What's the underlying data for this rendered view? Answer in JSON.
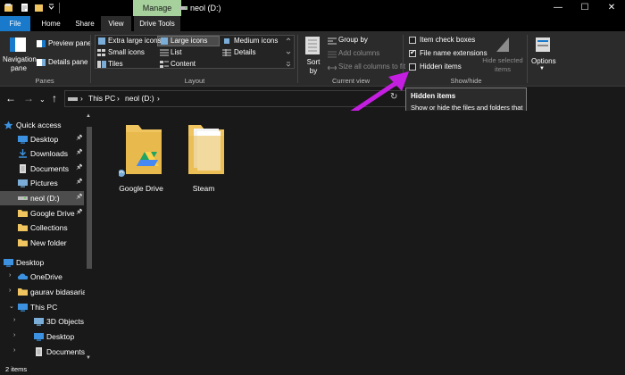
{
  "titlebar": {
    "manage_label": "Manage",
    "window_title": "neol (D:)",
    "minimize_glyph": "—",
    "maximize_glyph": "☐",
    "close_glyph": "✕"
  },
  "tabs": {
    "file": "File",
    "home": "Home",
    "share": "Share",
    "view": "View",
    "drive_tools": "Drive Tools"
  },
  "ribbon": {
    "panes": {
      "navigation_pane": "Navigation pane",
      "preview_pane": "Preview pane",
      "details_pane": "Details pane",
      "group_label": "Panes"
    },
    "layout": {
      "extra_large_icons": "Extra large icons",
      "large_icons": "Large icons",
      "medium_icons": "Medium icons",
      "small_icons": "Small icons",
      "list": "List",
      "details": "Details",
      "tiles": "Tiles",
      "content": "Content",
      "group_label": "Layout"
    },
    "current_view": {
      "sort_by": "Sort by",
      "group_by": "Group by",
      "add_columns": "Add columns",
      "size_all_columns": "Size all columns to fit",
      "group_label": "Current view"
    },
    "show_hide": {
      "item_check_boxes": "Item check boxes",
      "item_check_boxes_checked": false,
      "file_name_extensions": "File name extensions",
      "file_name_extensions_checked": true,
      "hidden_items": "Hidden items",
      "hidden_items_checked": false,
      "hide_selected_items": "Hide selected items",
      "group_label": "Show/hide"
    },
    "options": "Options"
  },
  "address": {
    "crumbs": [
      "This PC",
      "neol (D:)"
    ],
    "separator": "›"
  },
  "tooltip": {
    "title": "Hidden items",
    "body": "Show or hide the files and folders that are marked as hidden."
  },
  "nav": {
    "items": [
      {
        "label": "Quick access",
        "icon": "star-icon"
      },
      {
        "label": "Desktop",
        "icon": "desktop-icon"
      },
      {
        "label": "Downloads",
        "icon": "downloads-icon"
      },
      {
        "label": "Documents",
        "icon": "documents-icon"
      },
      {
        "label": "Pictures",
        "icon": "pictures-icon"
      },
      {
        "label": "neol (D:)",
        "icon": "drive-icon"
      },
      {
        "label": "Google Drive",
        "icon": "google-drive-icon"
      },
      {
        "label": "Collections",
        "icon": "folder-icon"
      },
      {
        "label": "New folder",
        "icon": "folder-icon"
      },
      {
        "label": "Desktop",
        "icon": "desktop-icon"
      },
      {
        "label": "OneDrive",
        "icon": "onedrive-icon"
      },
      {
        "label": "gaurav bidasaria",
        "icon": "user-icon"
      },
      {
        "label": "This PC",
        "icon": "computer-icon"
      },
      {
        "label": "3D Objects",
        "icon": "3d-objects-icon"
      },
      {
        "label": "Desktop",
        "icon": "desktop-icon"
      },
      {
        "label": "Documents",
        "icon": "documents-icon"
      }
    ]
  },
  "content": {
    "items": [
      {
        "label": "Google Drive",
        "icon": "google-drive-folder-icon"
      },
      {
        "label": "Steam",
        "icon": "folder-icon"
      }
    ]
  },
  "status": {
    "item_count": "2 items"
  },
  "colors": {
    "file_tab": "#1979ca",
    "manage_tab": "#a6d19d",
    "folder": "#f0c560",
    "annotation_arrow": "#c41fe0",
    "background": "#191919"
  }
}
